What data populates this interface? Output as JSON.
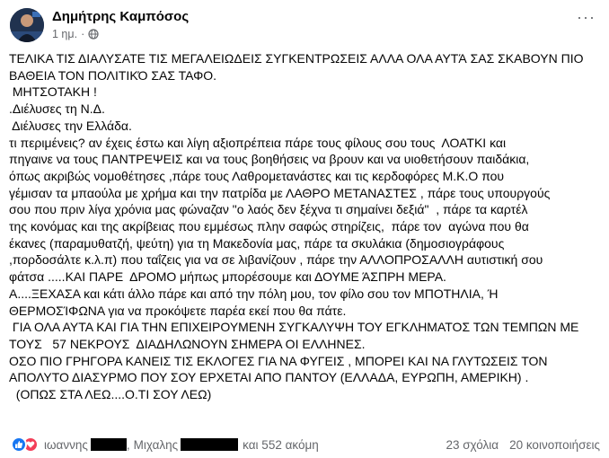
{
  "post": {
    "author": "Δημήτρης Καμπόσος",
    "time": "1 ημ.",
    "more_label": "···",
    "lines": [
      "ΤΕΛΙΚΑ ΤΙΣ ΔΙΑΛΥΣΑΤΕ ΤΙΣ ΜΕΓΑΛΕΙΩΔΕΙΣ ΣΥΓΚΕΝΤΡΩΣΕΙΣ ΑΛΛΑ ΟΛΑ ΑΥΤΆ ΣΑΣ ΣΚΑΒΟΥΝ ΠΙΟ",
      "ΒΑΘΕΙΑ ΤΟΝ ΠΟΛΙΤΙΚΌ ΣΑΣ ΤΑΦΟ.",
      " ΜΗΤΣΟΤΑΚΗ !",
      ".Διέλυσες τη Ν.Δ.",
      " Διέλυσες την Ελλάδα.",
      "τι περιμένεις? αν έχεις έστω και λίγη αξιοπρέπεια πάρε τους φίλους σου τους  ΛΟΑΤΚΙ και",
      "πηγαινε να τους ΠΑΝΤΡΕΨΕΙΣ και να τους βοηθήσεις να βρουν και να υιοθετήσουν παιδάκια,",
      "όπως ακριβώς νομοθέτησες ,πάρε τους Λαθρομετανάστες και τις κερδοφόρες Μ.Κ.Ο που",
      "γέμισαν τα μπαούλα με χρήμα και την πατρίδα με ΛΑΘΡΟ ΜΕΤΑΝΑΣΤΕΣ , πάρε τους υπουργούς",
      "σου που πριν λίγα χρόνια μας φώναζαν \"ο λαός δεν ξέχνα τι σημαίνει δεξιά\"  , πάρε τα καρτέλ",
      "της κονόμας και της ακρίβειας που εμμέσως πλην σαφώς στηρίζεις,  πάρε τον  αγώνα που θα",
      "έκανες (παραμυθατζή, ψεύτη) για τη Μακεδονία μας, πάρε τα σκυλάκια (δημοσιογράφους",
      ",πορδοσάλτε κ.λ.π) που ταΐζεις για να σε λιβανίζουν , πάρε την ΑΛΛΟΠΡΟΣΑΛΛΗ αυτιστική σου",
      "φάτσα .....ΚΑΙ ΠΑΡΕ  ΔΡΟΜΟ μήπως μπορέσουμε και ΔΟΥΜΕ ΆΣΠΡΗ ΜΕΡΑ.",
      "Α....ΞΕΧΑΣΑ και κάτι άλλο πάρε και από την πόλη μου, τον φίλο σου τον ΜΠΟΤΗΛΙΑ, Ή",
      "ΘΕΡΜΟΣΊΦΩΝΑ για να προκόψετε παρέα εκεί που θα πάτε.",
      " ΓΙΑ ΟΛΑ ΑΥΤΑ ΚΑΙ ΓΙΑ ΤΗΝ ΕΠΙΧΕΙΡΟΥΜΕΝΗ ΣΥΓΚΑΛΥΨΗ ΤΟΥ ΕΓΚΛΗΜΑΤΟΣ ΤΩΝ ΤΕΜΠΩΝ ΜΕ",
      "ΤΟΥΣ   57 ΝΕΚΡΟΥΣ  ΔΙΑΔΗΛΩΝΟΥΝ ΣΗΜΕΡΑ ΟΙ ΕΛΛΗΝΕΣ.",
      "ΟΣΟ ΠΙΟ ΓΡΗΓΟΡΑ ΚΑΝΕΙΣ ΤΙΣ ΕΚΛΟΓΕΣ ΓΙΑ ΝΑ ΦΥΓΕΙΣ , ΜΠΟΡΕΙ ΚΑΙ ΝΑ ΓΛΥΤΩΣΕΙΣ ΤΟΝ",
      "ΑΠΟΛΥΤΟ ΔΙΑΣΥΡΜΟ ΠΟΥ ΣΟΥ ΕΡΧΕΤΑΙ ΑΠΟ ΠΑΝΤΟΥ (ΕΛΛΑΔΑ, ΕΥΡΩΠΗ, ΑΜΕΡΙΚΗ) .",
      "  (ΟΠΩΣ ΣΤΑ ΛΕΩ....Ο.ΤΙ ΣΟΥ ΛΕΩ)"
    ]
  },
  "footer": {
    "name1": "ιωαννης",
    "sep": ",",
    "name2": "Μιχαλης",
    "others": "και 552 ακόμη",
    "comments": "23 σχόλια",
    "shares": "20 κοινοποιήσεις"
  },
  "colors": {
    "like": "#1877f2",
    "love": "#f33e58",
    "secondary_text": "#65676b"
  }
}
